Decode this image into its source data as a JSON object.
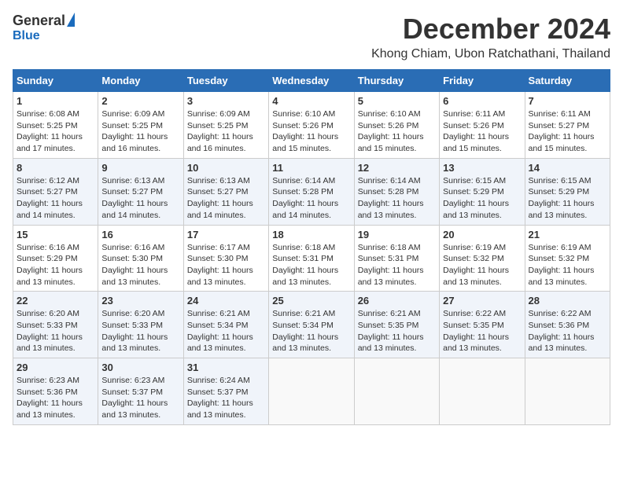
{
  "header": {
    "logo_general": "General",
    "logo_blue": "Blue",
    "month_title": "December 2024",
    "location": "Khong Chiam, Ubon Ratchathani, Thailand"
  },
  "calendar": {
    "columns": [
      "Sunday",
      "Monday",
      "Tuesday",
      "Wednesday",
      "Thursday",
      "Friday",
      "Saturday"
    ],
    "weeks": [
      [
        {
          "day": "",
          "info": ""
        },
        {
          "day": "2",
          "info": "Sunrise: 6:09 AM\nSunset: 5:25 PM\nDaylight: 11 hours and 16 minutes."
        },
        {
          "day": "3",
          "info": "Sunrise: 6:09 AM\nSunset: 5:25 PM\nDaylight: 11 hours and 16 minutes."
        },
        {
          "day": "4",
          "info": "Sunrise: 6:10 AM\nSunset: 5:26 PM\nDaylight: 11 hours and 15 minutes."
        },
        {
          "day": "5",
          "info": "Sunrise: 6:10 AM\nSunset: 5:26 PM\nDaylight: 11 hours and 15 minutes."
        },
        {
          "day": "6",
          "info": "Sunrise: 6:11 AM\nSunset: 5:26 PM\nDaylight: 11 hours and 15 minutes."
        },
        {
          "day": "7",
          "info": "Sunrise: 6:11 AM\nSunset: 5:27 PM\nDaylight: 11 hours and 15 minutes."
        }
      ],
      [
        {
          "day": "8",
          "info": "Sunrise: 6:12 AM\nSunset: 5:27 PM\nDaylight: 11 hours and 14 minutes."
        },
        {
          "day": "9",
          "info": "Sunrise: 6:13 AM\nSunset: 5:27 PM\nDaylight: 11 hours and 14 minutes."
        },
        {
          "day": "10",
          "info": "Sunrise: 6:13 AM\nSunset: 5:27 PM\nDaylight: 11 hours and 14 minutes."
        },
        {
          "day": "11",
          "info": "Sunrise: 6:14 AM\nSunset: 5:28 PM\nDaylight: 11 hours and 14 minutes."
        },
        {
          "day": "12",
          "info": "Sunrise: 6:14 AM\nSunset: 5:28 PM\nDaylight: 11 hours and 13 minutes."
        },
        {
          "day": "13",
          "info": "Sunrise: 6:15 AM\nSunset: 5:29 PM\nDaylight: 11 hours and 13 minutes."
        },
        {
          "day": "14",
          "info": "Sunrise: 6:15 AM\nSunset: 5:29 PM\nDaylight: 11 hours and 13 minutes."
        }
      ],
      [
        {
          "day": "15",
          "info": "Sunrise: 6:16 AM\nSunset: 5:29 PM\nDaylight: 11 hours and 13 minutes."
        },
        {
          "day": "16",
          "info": "Sunrise: 6:16 AM\nSunset: 5:30 PM\nDaylight: 11 hours and 13 minutes."
        },
        {
          "day": "17",
          "info": "Sunrise: 6:17 AM\nSunset: 5:30 PM\nDaylight: 11 hours and 13 minutes."
        },
        {
          "day": "18",
          "info": "Sunrise: 6:18 AM\nSunset: 5:31 PM\nDaylight: 11 hours and 13 minutes."
        },
        {
          "day": "19",
          "info": "Sunrise: 6:18 AM\nSunset: 5:31 PM\nDaylight: 11 hours and 13 minutes."
        },
        {
          "day": "20",
          "info": "Sunrise: 6:19 AM\nSunset: 5:32 PM\nDaylight: 11 hours and 13 minutes."
        },
        {
          "day": "21",
          "info": "Sunrise: 6:19 AM\nSunset: 5:32 PM\nDaylight: 11 hours and 13 minutes."
        }
      ],
      [
        {
          "day": "22",
          "info": "Sunrise: 6:20 AM\nSunset: 5:33 PM\nDaylight: 11 hours and 13 minutes."
        },
        {
          "day": "23",
          "info": "Sunrise: 6:20 AM\nSunset: 5:33 PM\nDaylight: 11 hours and 13 minutes."
        },
        {
          "day": "24",
          "info": "Sunrise: 6:21 AM\nSunset: 5:34 PM\nDaylight: 11 hours and 13 minutes."
        },
        {
          "day": "25",
          "info": "Sunrise: 6:21 AM\nSunset: 5:34 PM\nDaylight: 11 hours and 13 minutes."
        },
        {
          "day": "26",
          "info": "Sunrise: 6:21 AM\nSunset: 5:35 PM\nDaylight: 11 hours and 13 minutes."
        },
        {
          "day": "27",
          "info": "Sunrise: 6:22 AM\nSunset: 5:35 PM\nDaylight: 11 hours and 13 minutes."
        },
        {
          "day": "28",
          "info": "Sunrise: 6:22 AM\nSunset: 5:36 PM\nDaylight: 11 hours and 13 minutes."
        }
      ],
      [
        {
          "day": "29",
          "info": "Sunrise: 6:23 AM\nSunset: 5:36 PM\nDaylight: 11 hours and 13 minutes."
        },
        {
          "day": "30",
          "info": "Sunrise: 6:23 AM\nSunset: 5:37 PM\nDaylight: 11 hours and 13 minutes."
        },
        {
          "day": "31",
          "info": "Sunrise: 6:24 AM\nSunset: 5:37 PM\nDaylight: 11 hours and 13 minutes."
        },
        {
          "day": "",
          "info": ""
        },
        {
          "day": "",
          "info": ""
        },
        {
          "day": "",
          "info": ""
        },
        {
          "day": "",
          "info": ""
        }
      ]
    ],
    "week0_day1": {
      "day": "1",
      "info": "Sunrise: 6:08 AM\nSunset: 5:25 PM\nDaylight: 11 hours and 17 minutes."
    }
  }
}
